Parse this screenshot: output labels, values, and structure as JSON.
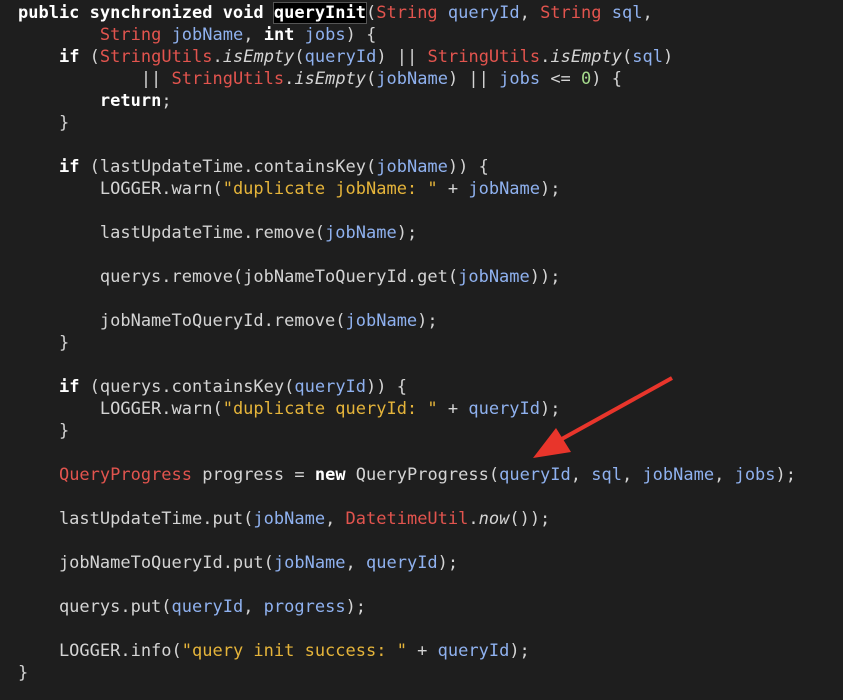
{
  "code": {
    "lines": [
      [
        [
          "kw",
          "public synchronized void "
        ],
        [
          "hl",
          "queryInit"
        ],
        [
          "pl",
          "("
        ],
        [
          "ty",
          "String"
        ],
        [
          "pl",
          " "
        ],
        [
          "pa",
          "queryId"
        ],
        [
          "pl",
          ", "
        ],
        [
          "ty",
          "String"
        ],
        [
          "pl",
          " "
        ],
        [
          "pa",
          "sql"
        ],
        [
          "pl",
          ","
        ]
      ],
      [
        [
          "pl",
          "        "
        ],
        [
          "ty",
          "String"
        ],
        [
          "pl",
          " "
        ],
        [
          "pa",
          "jobName"
        ],
        [
          "pl",
          ", "
        ],
        [
          "kw",
          "int"
        ],
        [
          "pl",
          " "
        ],
        [
          "pa",
          "jobs"
        ],
        [
          "pl",
          ") {"
        ]
      ],
      [
        [
          "pl",
          "    "
        ],
        [
          "kw",
          "if"
        ],
        [
          "pl",
          " ("
        ],
        [
          "ty",
          "StringUtils"
        ],
        [
          "pl",
          "."
        ],
        [
          "it",
          "isEmpty"
        ],
        [
          "pl",
          "("
        ],
        [
          "pa",
          "queryId"
        ],
        [
          "pl",
          ") || "
        ],
        [
          "ty",
          "StringUtils"
        ],
        [
          "pl",
          "."
        ],
        [
          "it",
          "isEmpty"
        ],
        [
          "pl",
          "("
        ],
        [
          "pa",
          "sql"
        ],
        [
          "pl",
          ")"
        ]
      ],
      [
        [
          "pl",
          "            || "
        ],
        [
          "ty",
          "StringUtils"
        ],
        [
          "pl",
          "."
        ],
        [
          "it",
          "isEmpty"
        ],
        [
          "pl",
          "("
        ],
        [
          "pa",
          "jobName"
        ],
        [
          "pl",
          ") || "
        ],
        [
          "pa",
          "jobs"
        ],
        [
          "pl",
          " <= "
        ],
        [
          "nu",
          "0"
        ],
        [
          "pl",
          ") {"
        ]
      ],
      [
        [
          "pl",
          "        "
        ],
        [
          "kw",
          "return"
        ],
        [
          "pl",
          ";"
        ]
      ],
      [
        [
          "pl",
          "    }"
        ]
      ],
      [],
      [
        [
          "pl",
          "    "
        ],
        [
          "kw",
          "if"
        ],
        [
          "pl",
          " (lastUpdateTime.containsKey("
        ],
        [
          "pa",
          "jobName"
        ],
        [
          "pl",
          ")) {"
        ]
      ],
      [
        [
          "pl",
          "        LOGGER.warn("
        ],
        [
          "st",
          "\"duplicate jobName: \""
        ],
        [
          "pl",
          " + "
        ],
        [
          "pa",
          "jobName"
        ],
        [
          "pl",
          ");"
        ]
      ],
      [],
      [
        [
          "pl",
          "        lastUpdateTime.remove("
        ],
        [
          "pa",
          "jobName"
        ],
        [
          "pl",
          ");"
        ]
      ],
      [],
      [
        [
          "pl",
          "        querys.remove(jobNameToQueryId.get("
        ],
        [
          "pa",
          "jobName"
        ],
        [
          "pl",
          "));"
        ]
      ],
      [],
      [
        [
          "pl",
          "        jobNameToQueryId.remove("
        ],
        [
          "pa",
          "jobName"
        ],
        [
          "pl",
          ");"
        ]
      ],
      [
        [
          "pl",
          "    }"
        ]
      ],
      [],
      [
        [
          "pl",
          "    "
        ],
        [
          "kw",
          "if"
        ],
        [
          "pl",
          " (querys.containsKey("
        ],
        [
          "pa",
          "queryId"
        ],
        [
          "pl",
          ")) {"
        ]
      ],
      [
        [
          "pl",
          "        LOGGER.warn("
        ],
        [
          "st",
          "\"duplicate queryId: \""
        ],
        [
          "pl",
          " + "
        ],
        [
          "pa",
          "queryId"
        ],
        [
          "pl",
          ");"
        ]
      ],
      [
        [
          "pl",
          "    }"
        ]
      ],
      [],
      [
        [
          "pl",
          "    "
        ],
        [
          "ty",
          "QueryProgress"
        ],
        [
          "pl",
          " progress = "
        ],
        [
          "kw",
          "new"
        ],
        [
          "pl",
          " QueryProgress("
        ],
        [
          "pa",
          "queryId"
        ],
        [
          "pl",
          ", "
        ],
        [
          "pa",
          "sql"
        ],
        [
          "pl",
          ", "
        ],
        [
          "pa",
          "jobName"
        ],
        [
          "pl",
          ", "
        ],
        [
          "pa",
          "jobs"
        ],
        [
          "pl",
          ");"
        ]
      ],
      [],
      [
        [
          "pl",
          "    lastUpdateTime.put("
        ],
        [
          "pa",
          "jobName"
        ],
        [
          "pl",
          ", "
        ],
        [
          "ty",
          "DatetimeUtil"
        ],
        [
          "pl",
          "."
        ],
        [
          "it",
          "now"
        ],
        [
          "pl",
          "());"
        ]
      ],
      [],
      [
        [
          "pl",
          "    jobNameToQueryId.put("
        ],
        [
          "pa",
          "jobName"
        ],
        [
          "pl",
          ", "
        ],
        [
          "pa",
          "queryId"
        ],
        [
          "pl",
          ");"
        ]
      ],
      [],
      [
        [
          "pl",
          "    querys.put("
        ],
        [
          "pa",
          "queryId"
        ],
        [
          "pl",
          ", "
        ],
        [
          "pa",
          "progress"
        ],
        [
          "pl",
          ");"
        ]
      ],
      [],
      [
        [
          "pl",
          "    LOGGER.info("
        ],
        [
          "st",
          "\"query init success: \""
        ],
        [
          "pl",
          " + "
        ],
        [
          "pa",
          "queryId"
        ],
        [
          "pl",
          ");"
        ]
      ],
      [
        [
          "pl",
          "}"
        ]
      ]
    ]
  },
  "colors": {
    "background": "#1e1e1e",
    "keyword": "#ffffff",
    "type": "#e2544e",
    "parameter": "#8fb1ef",
    "string": "#e5b43a",
    "number": "#a4d98b",
    "plain": "#d4d4d4",
    "arrow": "#e8352b"
  }
}
